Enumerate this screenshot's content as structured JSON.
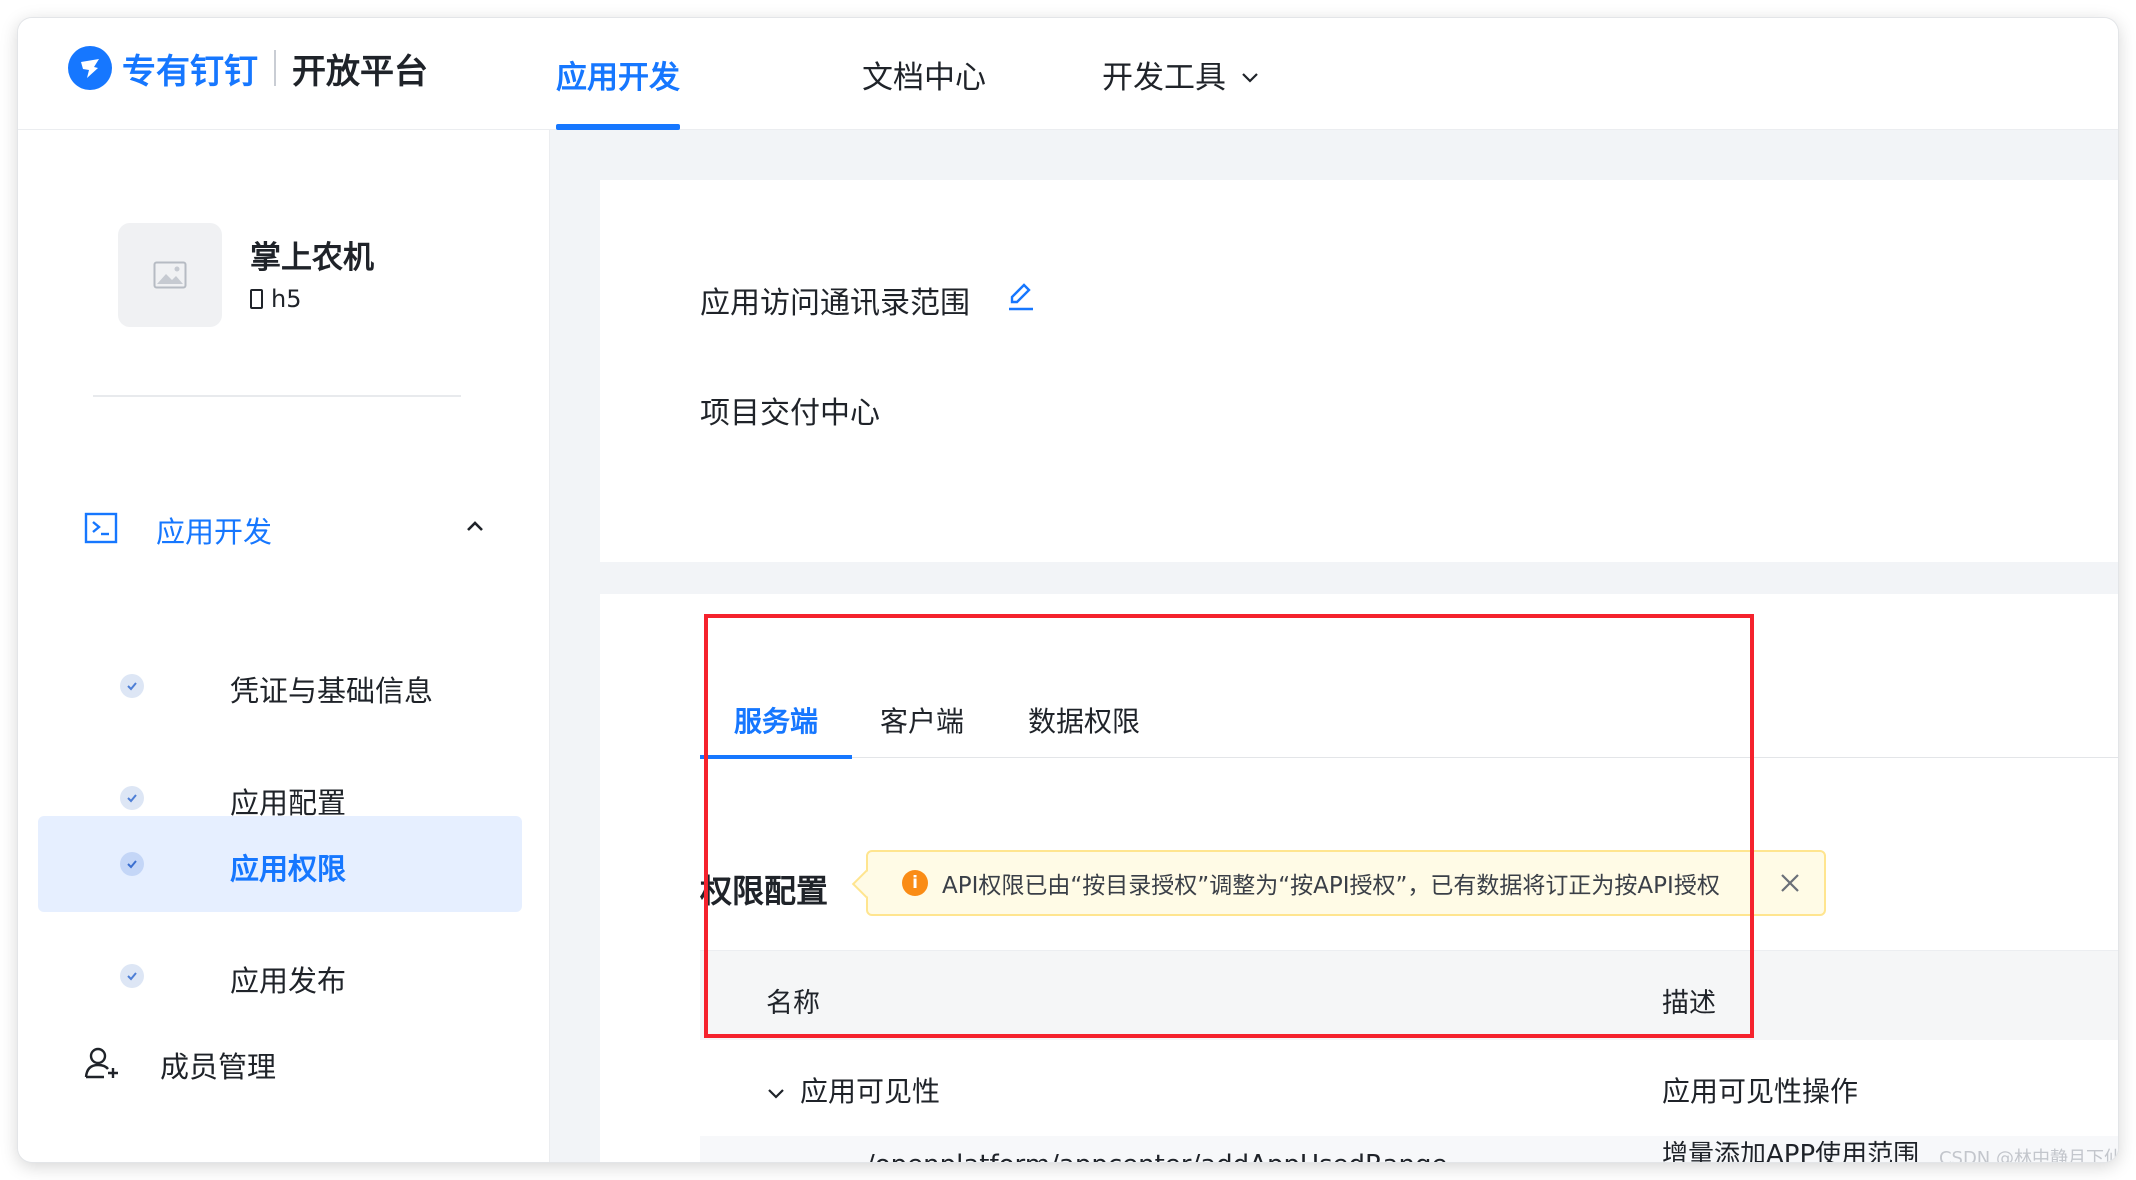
{
  "brand": {
    "name": "专有钉钉",
    "platform": "开放平台",
    "accent": "#1677ff"
  },
  "topnav": {
    "items": [
      {
        "label": "应用开发",
        "active": true
      },
      {
        "label": "文档中心",
        "active": false
      },
      {
        "label": "开发工具",
        "active": false
      }
    ]
  },
  "app": {
    "name": "掌上农机",
    "type": "h5"
  },
  "sidebar": {
    "group": "应用开发",
    "items": [
      "凭证与基础信息",
      "应用配置",
      "应用权限",
      "应用发布"
    ],
    "active_item": "应用权限",
    "members": "成员管理"
  },
  "scope": {
    "title": "应用访问通讯录范围",
    "value": "项目交付中心"
  },
  "permissions": {
    "tabs": [
      "服务端",
      "客户端",
      "数据权限"
    ],
    "active_tab": "服务端",
    "heading": "权限配置",
    "notice": "API权限已由“按目录授权”调整为“按API授权”，已有数据将订正为按API授权",
    "columns": {
      "name": "名称",
      "desc": "描述"
    },
    "group_row": {
      "name": "应用可见性",
      "desc": "应用可见性操作"
    },
    "sub_row": {
      "name": "/openplatform/appcenter/addAppUsedRange",
      "desc": "增量添加APP使用范围"
    }
  },
  "watermark": "CSDN @林中静月下仙",
  "colors": {
    "highlight": "#f5222d",
    "notice_bg": "#fffbe6",
    "warning": "#fa8c16"
  }
}
